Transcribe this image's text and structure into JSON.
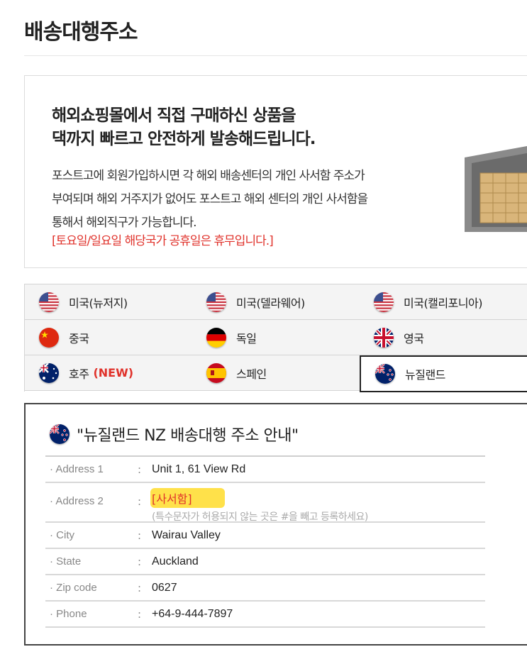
{
  "page": {
    "title": "배송대행주소"
  },
  "intro": {
    "headline_line1": "해외쇼핑몰에서 직접 구매하신 상품을",
    "headline_line2": "댁까지 빠르고 안전하게 발송해드립니다.",
    "body_line1": "포스트고에 회원가입하시면 각 해외 배송센터의 개인 사서함 주소가",
    "body_line2": "부여되며 해외 거주지가 없어도 포스트고 해외 센터의 개인 사서함을",
    "body_line3": "통해서 해외직구가 가능합니다.",
    "notice": "[토요일/일요일 해당국가 공휴일은 휴무입니다.]"
  },
  "countries": [
    {
      "label": "미국(뉴저지)",
      "flag": "us-flag-icon"
    },
    {
      "label": "미국(델라웨어)",
      "flag": "us-flag-icon"
    },
    {
      "label": "미국(캘리포니아)",
      "flag": "us-flag-icon"
    },
    {
      "label": "중국",
      "flag": "china-flag-icon"
    },
    {
      "label": "독일",
      "flag": "germany-flag-icon"
    },
    {
      "label": "영국",
      "flag": "uk-flag-icon"
    },
    {
      "label": "호주",
      "badge": "(NEW)",
      "flag": "australia-flag-icon"
    },
    {
      "label": "스페인",
      "flag": "spain-flag-icon"
    },
    {
      "label": "뉴질랜드",
      "flag": "newzealand-flag-icon",
      "selected": true
    }
  ],
  "address": {
    "title": "\"뉴질랜드 NZ 배송대행 주소 안내\"",
    "colon": ":",
    "rows": [
      {
        "label": "· Address 1",
        "value": "Unit 1, 61 View Rd"
      },
      {
        "label": "· Address 2",
        "value": "[사서함]",
        "note": "(특수문자가 허용되지 않는 곳은 #을 빼고 등록하세요)"
      },
      {
        "label": "· City",
        "value": "Wairau Valley"
      },
      {
        "label": "· State",
        "value": "Auckland"
      },
      {
        "label": "· Zip code",
        "value": "0627"
      },
      {
        "label": "· Phone",
        "value": "+64-9-444-7897"
      }
    ]
  },
  "colors": {
    "accent_red": "#e0322b",
    "highlight_yellow": "#ffe14a",
    "grid_bg": "#f4f4f4"
  }
}
